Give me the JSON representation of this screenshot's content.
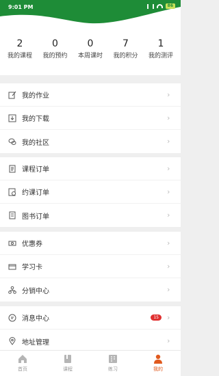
{
  "status": {
    "time": "9:01 PM",
    "battery": "86"
  },
  "stats": [
    {
      "value": "2",
      "label": "我的课程"
    },
    {
      "value": "0",
      "label": "我的预约"
    },
    {
      "value": "0",
      "label": "本周课时"
    },
    {
      "value": "7",
      "label": "我的积分"
    },
    {
      "value": "1",
      "label": "我的测评"
    }
  ],
  "groups": {
    "g1": [
      {
        "label": "我的作业",
        "icon": "edit-icon"
      },
      {
        "label": "我的下载",
        "icon": "download-icon"
      },
      {
        "label": "我的社区",
        "icon": "community-icon"
      }
    ],
    "g2": [
      {
        "label": "课程订单",
        "icon": "course-order-icon"
      },
      {
        "label": "约课订单",
        "icon": "appointment-order-icon"
      },
      {
        "label": "图书订单",
        "icon": "book-order-icon"
      }
    ],
    "g3": [
      {
        "label": "优惠券",
        "icon": "coupon-icon"
      },
      {
        "label": "学习卡",
        "icon": "study-card-icon"
      },
      {
        "label": "分销中心",
        "icon": "distribution-icon"
      }
    ],
    "g4": [
      {
        "label": "消息中心",
        "icon": "message-icon",
        "badge": "15"
      },
      {
        "label": "地址管理",
        "icon": "location-icon"
      }
    ]
  },
  "tabs": [
    {
      "label": "首页",
      "icon": "home-icon"
    },
    {
      "label": "课程",
      "icon": "course-icon"
    },
    {
      "label": "练习",
      "icon": "practice-icon"
    },
    {
      "label": "我的",
      "icon": "profile-icon"
    }
  ],
  "colors": {
    "brand": "#1e8c37",
    "active_tab": "#e05a1e",
    "badge": "#e03131"
  }
}
